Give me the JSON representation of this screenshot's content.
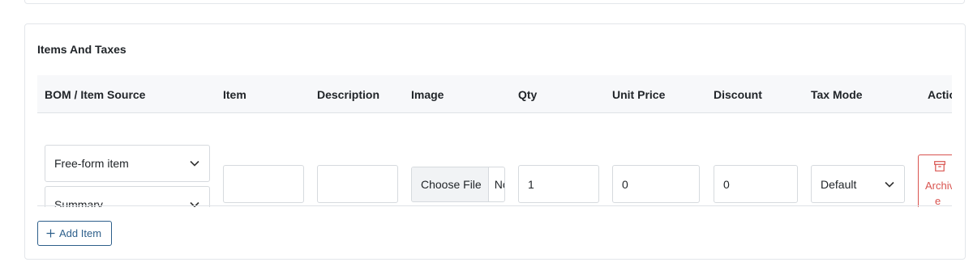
{
  "section": {
    "title": "Items And Taxes"
  },
  "table": {
    "headers": [
      "BOM / Item Source",
      "Item",
      "Description",
      "Image",
      "Qty",
      "Unit Price",
      "Discount",
      "Tax Mode",
      "Actio"
    ],
    "row": {
      "source_select": "Free-form item",
      "bom_select": "Summary",
      "item_value": "",
      "description_value": "",
      "image": {
        "button_label": "Choose File",
        "status_text": "No"
      },
      "qty": "1",
      "unit_price": "0",
      "discount": "0",
      "tax_mode": "Default",
      "archive": {
        "label_line1": "Archiv",
        "label_line2": "e",
        "icon": "archive-icon"
      }
    }
  },
  "add_item": {
    "label": "Add Item",
    "icon": "plus-icon"
  },
  "colors": {
    "primary": "#2d5f8b",
    "danger": "#d9534f",
    "header_bg": "#f7f8fa",
    "border": "#d6dade"
  }
}
